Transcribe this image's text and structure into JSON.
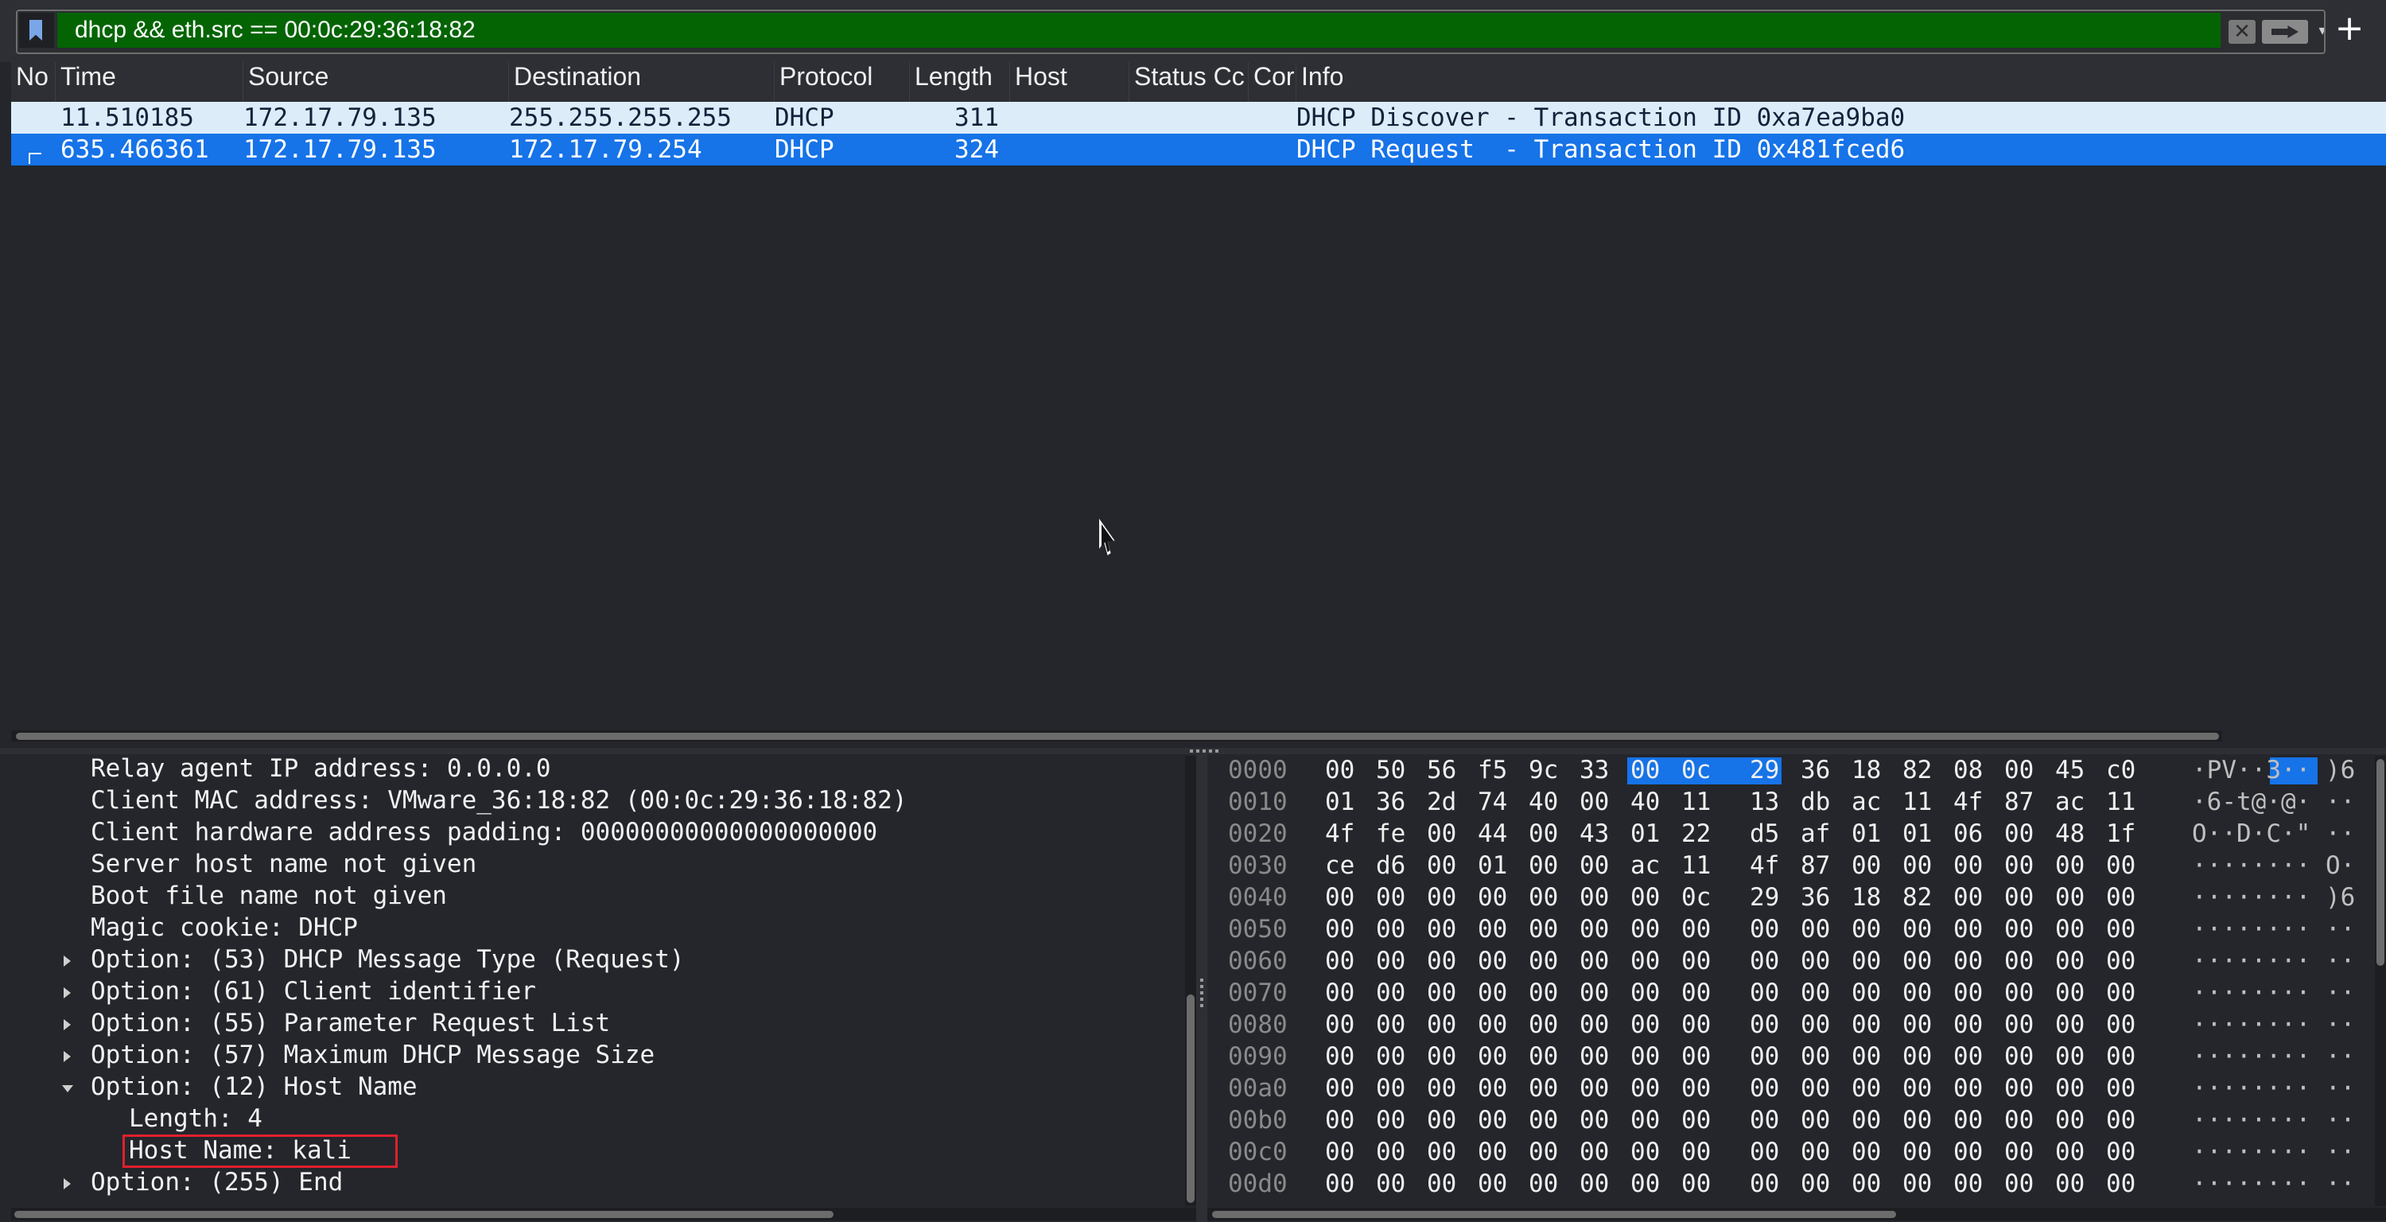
{
  "filter": {
    "value": "dhcp && eth.src == 00:0c:29:36:18:82",
    "clear_glyph": "✕",
    "dropdown_glyph": "▾",
    "add_glyph": "+",
    "color": "#046404"
  },
  "packet_list": {
    "columns": [
      "No",
      "Time",
      "Source",
      "Destination",
      "Protocol",
      "Length",
      "Host",
      "Status Cc",
      "Cor",
      "Info"
    ],
    "rows": [
      {
        "time": "11.510185",
        "source": "172.17.79.135",
        "destination": "255.255.255.255",
        "protocol": "DHCP",
        "length": "311",
        "host": "",
        "status": "",
        "conv": "",
        "info": "DHCP Discover - Transaction ID 0xa7ea9ba0",
        "selected": false
      },
      {
        "time": "635.466361",
        "source": "172.17.79.135",
        "destination": "172.17.79.254",
        "protocol": "DHCP",
        "length": "324",
        "host": "",
        "status": "",
        "conv": "",
        "info": "DHCP Request  - Transaction ID 0x481fced6",
        "selected": true
      }
    ],
    "selection_color": "#1673e8"
  },
  "details": {
    "lines": [
      {
        "text": "Relay agent IP address: 0.0.0.0",
        "expander": "none",
        "indent": 1
      },
      {
        "text": "Client MAC address: VMware_36:18:82 (00:0c:29:36:18:82)",
        "expander": "none",
        "indent": 1
      },
      {
        "text": "Client hardware address padding: 00000000000000000000",
        "expander": "none",
        "indent": 1
      },
      {
        "text": "Server host name not given",
        "expander": "none",
        "indent": 1
      },
      {
        "text": "Boot file name not given",
        "expander": "none",
        "indent": 1
      },
      {
        "text": "Magic cookie: DHCP",
        "expander": "none",
        "indent": 1
      },
      {
        "text": "Option: (53) DHCP Message Type (Request)",
        "expander": "collapsed",
        "indent": 1
      },
      {
        "text": "Option: (61) Client identifier",
        "expander": "collapsed",
        "indent": 1
      },
      {
        "text": "Option: (55) Parameter Request List",
        "expander": "collapsed",
        "indent": 1
      },
      {
        "text": "Option: (57) Maximum DHCP Message Size",
        "expander": "collapsed",
        "indent": 1
      },
      {
        "text": "Option: (12) Host Name",
        "expander": "expanded",
        "indent": 1
      },
      {
        "text": "Length: 4",
        "expander": "none",
        "indent": 2
      },
      {
        "text": "Host Name: kali",
        "expander": "none",
        "indent": 2,
        "highlighted": true
      },
      {
        "text": "Option: (255) End",
        "expander": "collapsed",
        "indent": 1
      }
    ],
    "highlight_color": "#e0202e"
  },
  "bytes": {
    "rows": [
      {
        "offset": "0000",
        "hex": [
          "00",
          "50",
          "56",
          "f5",
          "9c",
          "33",
          "00",
          "0c",
          "29",
          "36",
          "18",
          "82",
          "08",
          "00",
          "45",
          "c0"
        ],
        "ascii": "·PV··3·· )6"
      },
      {
        "offset": "0010",
        "hex": [
          "01",
          "36",
          "2d",
          "74",
          "40",
          "00",
          "40",
          "11",
          "13",
          "db",
          "ac",
          "11",
          "4f",
          "87",
          "ac",
          "11"
        ],
        "ascii": "·6-t@·@· ··"
      },
      {
        "offset": "0020",
        "hex": [
          "4f",
          "fe",
          "00",
          "44",
          "00",
          "43",
          "01",
          "22",
          "d5",
          "af",
          "01",
          "01",
          "06",
          "00",
          "48",
          "1f"
        ],
        "ascii": "O··D·C·\" ··"
      },
      {
        "offset": "0030",
        "hex": [
          "ce",
          "d6",
          "00",
          "01",
          "00",
          "00",
          "ac",
          "11",
          "4f",
          "87",
          "00",
          "00",
          "00",
          "00",
          "00",
          "00"
        ],
        "ascii": "········ O·"
      },
      {
        "offset": "0040",
        "hex": [
          "00",
          "00",
          "00",
          "00",
          "00",
          "00",
          "00",
          "0c",
          "29",
          "36",
          "18",
          "82",
          "00",
          "00",
          "00",
          "00"
        ],
        "ascii": "········ )6"
      },
      {
        "offset": "0050",
        "hex": [
          "00",
          "00",
          "00",
          "00",
          "00",
          "00",
          "00",
          "00",
          "00",
          "00",
          "00",
          "00",
          "00",
          "00",
          "00",
          "00"
        ],
        "ascii": "········ ··"
      },
      {
        "offset": "0060",
        "hex": [
          "00",
          "00",
          "00",
          "00",
          "00",
          "00",
          "00",
          "00",
          "00",
          "00",
          "00",
          "00",
          "00",
          "00",
          "00",
          "00"
        ],
        "ascii": "········ ··"
      },
      {
        "offset": "0070",
        "hex": [
          "00",
          "00",
          "00",
          "00",
          "00",
          "00",
          "00",
          "00",
          "00",
          "00",
          "00",
          "00",
          "00",
          "00",
          "00",
          "00"
        ],
        "ascii": "········ ··"
      },
      {
        "offset": "0080",
        "hex": [
          "00",
          "00",
          "00",
          "00",
          "00",
          "00",
          "00",
          "00",
          "00",
          "00",
          "00",
          "00",
          "00",
          "00",
          "00",
          "00"
        ],
        "ascii": "········ ··"
      },
      {
        "offset": "0090",
        "hex": [
          "00",
          "00",
          "00",
          "00",
          "00",
          "00",
          "00",
          "00",
          "00",
          "00",
          "00",
          "00",
          "00",
          "00",
          "00",
          "00"
        ],
        "ascii": "········ ··"
      },
      {
        "offset": "00a0",
        "hex": [
          "00",
          "00",
          "00",
          "00",
          "00",
          "00",
          "00",
          "00",
          "00",
          "00",
          "00",
          "00",
          "00",
          "00",
          "00",
          "00"
        ],
        "ascii": "········ ··"
      },
      {
        "offset": "00b0",
        "hex": [
          "00",
          "00",
          "00",
          "00",
          "00",
          "00",
          "00",
          "00",
          "00",
          "00",
          "00",
          "00",
          "00",
          "00",
          "00",
          "00"
        ],
        "ascii": "········ ··"
      },
      {
        "offset": "00c0",
        "hex": [
          "00",
          "00",
          "00",
          "00",
          "00",
          "00",
          "00",
          "00",
          "00",
          "00",
          "00",
          "00",
          "00",
          "00",
          "00",
          "00"
        ],
        "ascii": "········ ··"
      },
      {
        "offset": "00d0",
        "hex": [
          "00",
          "00",
          "00",
          "00",
          "00",
          "00",
          "00",
          "00",
          "00",
          "00",
          "00",
          "00",
          "00",
          "00",
          "00",
          "00"
        ],
        "ascii": "········ ··"
      }
    ],
    "selected_bytes": {
      "row": 0,
      "from": 6,
      "to": 8
    }
  }
}
